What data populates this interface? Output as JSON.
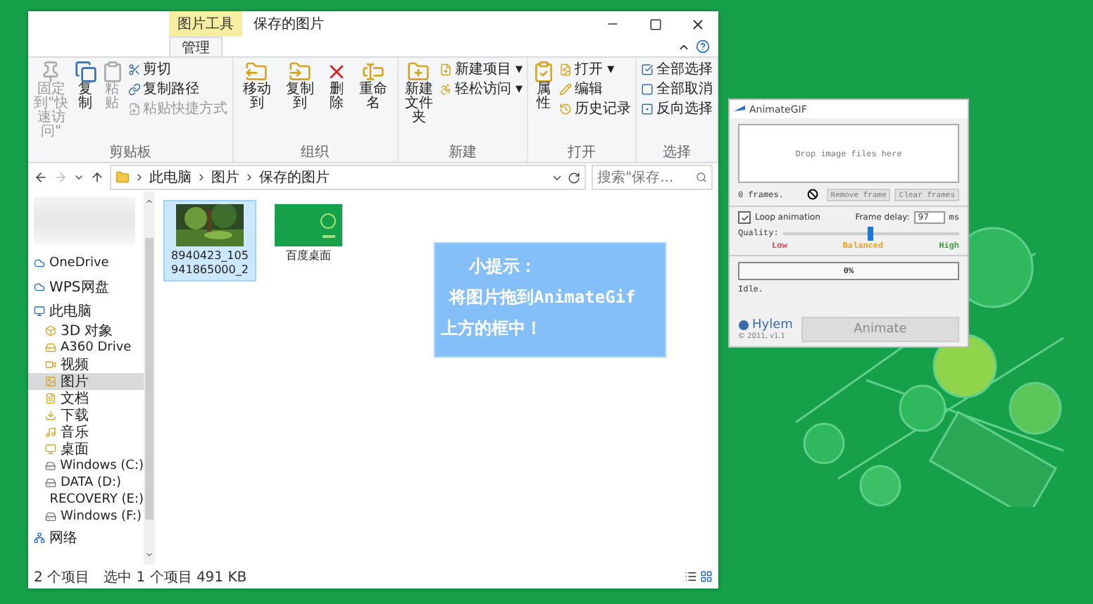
{
  "explorer": {
    "title": "保存的图片",
    "context_tab": "图片工具",
    "tabs": [
      {
        "label": "管理",
        "selected": true
      }
    ],
    "ribbon": [
      {
        "label": "剪贴板",
        "items": [
          {
            "kind": "large",
            "label": "固定到\"快速访问\"",
            "disabled": true
          },
          {
            "kind": "large",
            "label": "复制",
            "disabled": false
          },
          {
            "kind": "large",
            "label": "粘贴",
            "disabled": true
          },
          {
            "kind": "small",
            "label": "剪切",
            "disabled": false
          },
          {
            "kind": "small",
            "label": "复制路径",
            "disabled": false
          },
          {
            "kind": "small",
            "label": "粘贴快捷方式",
            "disabled": true
          }
        ]
      },
      {
        "label": "组织",
        "items": [
          {
            "kind": "large",
            "label": "移动到",
            "disabled": false
          },
          {
            "kind": "large",
            "label": "复制到",
            "disabled": false
          },
          {
            "kind": "large",
            "label": "删除",
            "disabled": false
          },
          {
            "kind": "large",
            "label": "重命名",
            "disabled": false
          }
        ]
      },
      {
        "label": "新建",
        "items": [
          {
            "kind": "large",
            "label": "新建文件夹",
            "disabled": false
          },
          {
            "kind": "small",
            "label": "新建项目 ▾",
            "disabled": false
          },
          {
            "kind": "small",
            "label": "轻松访问 ▾",
            "disabled": false
          }
        ]
      },
      {
        "label": "打开",
        "items": [
          {
            "kind": "large",
            "label": "属性",
            "disabled": false
          },
          {
            "kind": "small",
            "label": "打开 ▾",
            "disabled": false
          },
          {
            "kind": "small",
            "label": "编辑",
            "disabled": false
          },
          {
            "kind": "small",
            "label": "历史记录",
            "disabled": false
          }
        ]
      },
      {
        "label": "选择",
        "items": [
          {
            "kind": "small",
            "label": "全部选择",
            "disabled": false
          },
          {
            "kind": "small",
            "label": "全部取消",
            "disabled": false
          },
          {
            "kind": "small",
            "label": "反向选择",
            "disabled": false
          }
        ]
      }
    ],
    "path": [
      "此电脑",
      "图片",
      "保存的图片"
    ],
    "search": {
      "placeholder": "搜索\"保存..."
    },
    "nav": [
      {
        "label": "OneDrive",
        "selected": false
      },
      {
        "label": "WPS网盘",
        "selected": false
      },
      {
        "label": "此电脑",
        "selected": false,
        "children": [
          {
            "label": "3D 对象",
            "selected": false
          },
          {
            "label": "A360 Drive",
            "selected": false
          },
          {
            "label": "视频",
            "selected": false
          },
          {
            "label": "图片",
            "selected": true
          },
          {
            "label": "文档",
            "selected": false
          },
          {
            "label": "下载",
            "selected": false
          },
          {
            "label": "音乐",
            "selected": false
          },
          {
            "label": "桌面",
            "selected": false
          },
          {
            "label": "Windows (C:)",
            "selected": false
          },
          {
            "label": "DATA (D:)",
            "selected": false
          },
          {
            "label": "RECOVERY (E:)",
            "selected": false
          },
          {
            "label": "Windows (F:)",
            "selected": false
          }
        ]
      },
      {
        "label": "网络",
        "selected": false
      }
    ],
    "files": [
      {
        "name": "8940423_105941865000_2",
        "selected": true
      },
      {
        "name": "百度桌面",
        "kind": "green",
        "selected": false
      }
    ],
    "status": {
      "count": "2 个项目",
      "selection": "选中 1 个项目  491 KB"
    }
  },
  "tip": {
    "title": "小提示：",
    "lines": [
      "将图片拖到AnimateGif",
      "上方的框中！"
    ]
  },
  "animategif": {
    "title": "AnimateGIF",
    "drop_hint": "Drop image files here",
    "frames": "0 frames.",
    "buttons": [
      {
        "label": "Remove frame",
        "disabled": true
      },
      {
        "label": "Clear frames",
        "disabled": true
      }
    ],
    "loop": {
      "label": "Loop animation",
      "checked": true
    },
    "delay": {
      "label": "Frame delay:",
      "value": "97",
      "unit": "ms"
    },
    "quality": {
      "label": "Quality:",
      "level": 0.5,
      "marks": [
        {
          "label": "Low",
          "color": "#e0405a"
        },
        {
          "label": "Balanced",
          "color": "#f0a020"
        },
        {
          "label": "High",
          "color": "#3a9a3a"
        }
      ]
    },
    "progress": {
      "reading": "0%",
      "level": 0
    },
    "status": "Idle.",
    "logo": "Hylem",
    "copyright": "© 2011, v1.1",
    "action": {
      "label": "Animate",
      "disabled": true
    }
  }
}
